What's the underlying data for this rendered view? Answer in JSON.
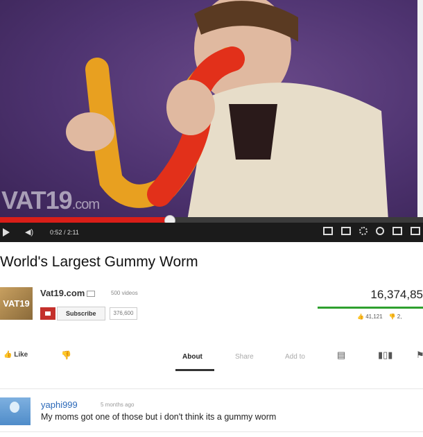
{
  "video": {
    "watermark_main": "VAT19",
    "watermark_suffix": ".com",
    "progress_fraction": 0.4,
    "time_display": "0:52 / 2:11"
  },
  "title": "World's Largest Gummy Worm",
  "channel": {
    "avatar_text": "VAT19",
    "name": "Vat19.com",
    "video_count": "500 videos",
    "subscribe_label": "Subscribe",
    "subscriber_count": "376,600"
  },
  "stats": {
    "views": "16,374,85",
    "likes": "41,121",
    "dislikes": "2,"
  },
  "actions": {
    "like_label": "Like",
    "tabs": [
      "About",
      "Share",
      "Add to"
    ]
  },
  "comment": {
    "user": "yaphi999",
    "time": "5 months ago",
    "text": "My moms got one of those but i don't think its a gummy worm"
  },
  "colors": {
    "accent": "#d91e18",
    "views_bar": "#2ea02e",
    "link": "#2a68b8"
  }
}
